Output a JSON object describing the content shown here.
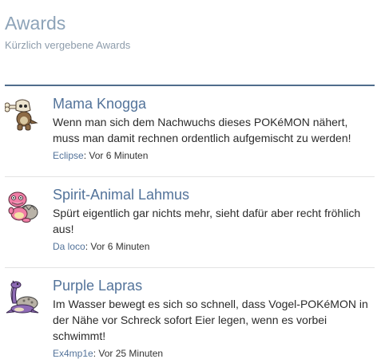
{
  "header": {
    "title": "Awards",
    "subtitle": "Kürzlich vergebene Awards"
  },
  "awards": [
    {
      "name": "Mama Knogga",
      "description": "Wenn man sich dem Nachwuchs dieses POKéMON nähert, muss man damit rechnen ordentlich aufgemischt zu werden!",
      "user": "Eclipse",
      "separator": ": ",
      "time": "Vor 6 Minuten",
      "icon": "marowak-sprite-icon"
    },
    {
      "name": "Spirit-Animal Lahmus",
      "description": "Spürt eigentlich gar nichts mehr, sieht dafür aber recht fröhlich aus!",
      "user": "Da loco",
      "separator": ": ",
      "time": "Vor 6 Minuten",
      "icon": "slowbro-sprite-icon"
    },
    {
      "name": "Purple Lapras",
      "description": "Im Wasser bewegt es sich so schnell, dass Vogel-POKéMON in der Nähe vor Schreck sofort Eier legen, wenn es vorbei schwimmt!",
      "user": "Ex4mp1e",
      "separator": ": ",
      "time": "Vor 25 Minuten",
      "icon": "lapras-sprite-icon"
    }
  ],
  "colors": {
    "accent": "#53739a",
    "title": "#8da3b8",
    "divider": "#4f6d8c"
  }
}
